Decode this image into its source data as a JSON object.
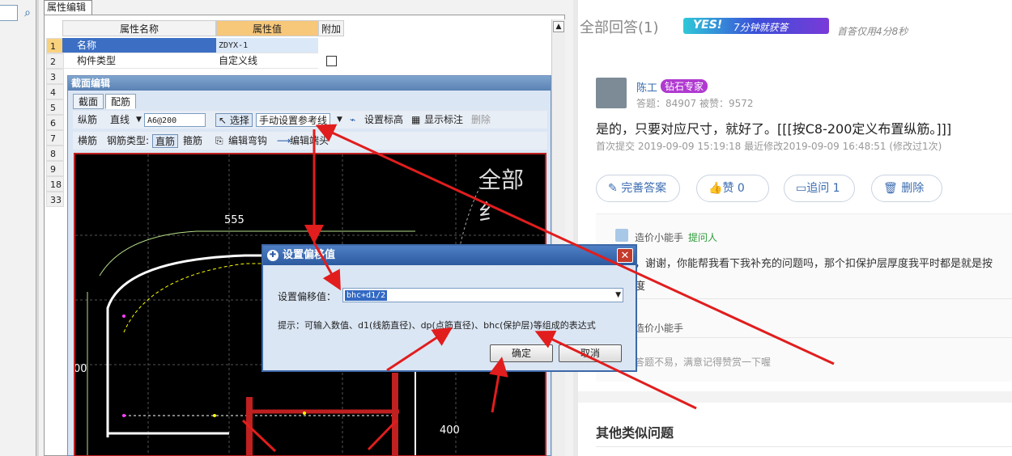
{
  "left": {
    "prop_tab": "属性编辑",
    "table": {
      "headers": [
        "属性名称",
        "属性值",
        "附加"
      ],
      "rows": [
        {
          "num": "1",
          "name": "名称",
          "value": "ZDYX-1"
        },
        {
          "num": "2",
          "name": "构件类型",
          "value": "自定义线"
        },
        {
          "num": "3",
          "name": "",
          "value": ""
        },
        {
          "num": "4",
          "name": "",
          "value": ""
        },
        {
          "num": "5",
          "name": "",
          "value": ""
        },
        {
          "num": "6",
          "name": "",
          "value": ""
        },
        {
          "num": "7",
          "name": "",
          "value": ""
        },
        {
          "num": "8",
          "name": "",
          "value": ""
        },
        {
          "num": "9",
          "name": "",
          "value": ""
        },
        {
          "num": "18",
          "name": "",
          "value": ""
        },
        {
          "num": "33",
          "name": "",
          "value": ""
        }
      ]
    }
  },
  "section_editor": {
    "title": "截面编辑",
    "tabs": [
      "截面",
      "配筋"
    ],
    "toolbar1": {
      "label": "纵筋",
      "line_type": "直线",
      "rebar_spec": "A6@200",
      "select": "选择",
      "manual_ref": "手动设置参考线",
      "set_elev": "设置标高",
      "show_mark": "显示标注",
      "delete": "删除"
    },
    "toolbar2": {
      "label": "横筋",
      "type_label": "钢筋类型:",
      "straight": "直筋",
      "stirrup": "箍筋",
      "edit_hook": "编辑弯钩",
      "edit_end": "编辑端头"
    },
    "cad": {
      "dim_top": "555",
      "dim_right": "400",
      "dim_left": "00",
      "overlay": "全部纟"
    }
  },
  "dialog": {
    "title": "设置偏移值",
    "label": "设置偏移值：",
    "value": "bhc+d1/2",
    "hint": "提示：可输入数值、d1(线筋直径)、dp(点筋直径)、bhc(保护层)等组成的表达式",
    "ok": "确定",
    "cancel": "取消"
  },
  "right": {
    "answers_title": "全部回答(1)",
    "badge_yes": "YES!",
    "badge_fast": "7分钟就获答",
    "first_answer": "首答仅用4分8秒",
    "user_name": "陈工",
    "user_tag": "钻石专家",
    "stats": "答题：84907   被赞：9572",
    "answer_text": "是的，只要对应尺寸，就好了。[[[按C8-200定义布置纵筋。]]]",
    "meta": "首次提交 2019-09-09 15:19:18  最近修改2019-09-09 16:48:51 (修改过1次)",
    "btn_improve": "完善答案",
    "btn_like": "赞 0",
    "btn_ask": "追问  1",
    "btn_delete": "删除",
    "asker_name": "造价小能手",
    "asker_tag": "提问人",
    "asker_text": "，谢谢，你能帮我看下我补充的问题吗，那个扣保护层厚度我平时都是就是按",
    "asker_text2": "度",
    "reply_name": "造价小能手",
    "reply_text": "答题不易，满意记得赞赏一下喔",
    "similar_title": "其他类似问题"
  },
  "colors": {
    "annotation_red": "#e11d1d",
    "cad_background": "#000000",
    "link_blue": "#3a6bb0",
    "expert_purple": "#b03ad0",
    "asker_green": "#2d9b38"
  }
}
